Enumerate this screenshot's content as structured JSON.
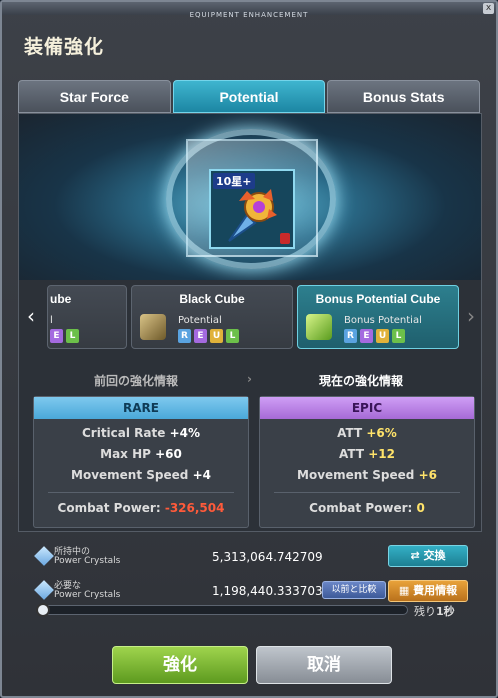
{
  "window": {
    "title": "EQUIPMENT ENHANCEMENT",
    "close_glyph": "x"
  },
  "heading": "装備強化",
  "tabs": [
    {
      "label": "Star Force",
      "active": false
    },
    {
      "label": "Potential",
      "active": true
    },
    {
      "label": "Bonus Stats",
      "active": false
    }
  ],
  "item": {
    "star_label": "10星+",
    "icon": "sword-item-icon"
  },
  "cubes": [
    {
      "name": "ube",
      "sub": "l",
      "grades": [
        "E",
        "L"
      ]
    },
    {
      "name": "Black Cube",
      "sub": "Potential",
      "grades": [
        "R",
        "E",
        "U",
        "L"
      ]
    },
    {
      "name": "Bonus Potential Cube",
      "sub": "Bonus Potential",
      "grades": [
        "R",
        "E",
        "U",
        "L"
      ]
    }
  ],
  "compare": {
    "prev_title": "前回の強化情報",
    "curr_title": "現在の強化情報",
    "prev": {
      "grade": "RARE",
      "stats": [
        {
          "label": "Critical Rate",
          "value": "+4%"
        },
        {
          "label": "Max HP",
          "value": "+60"
        },
        {
          "label": "Movement Speed",
          "value": "+4"
        }
      ],
      "combat_label": "Combat Power:",
      "combat_value": "-326,504"
    },
    "curr": {
      "grade": "EPIC",
      "stats": [
        {
          "label": "ATT",
          "value": "+6%"
        },
        {
          "label": "ATT",
          "value": "+12"
        },
        {
          "label": "Movement Speed",
          "value": "+6"
        }
      ],
      "combat_label": "Combat Power:",
      "combat_value": "0"
    }
  },
  "crystals": {
    "owned_label_jp": "所持中の",
    "owned_label_en": "Power Crystals",
    "owned_value": "5,313,064.742709",
    "exchange_label": "交換",
    "required_label_jp": "必要な",
    "required_label_en": "Power Crystals",
    "required_value": "1,198,440.333703",
    "compare_label": "以前と比較",
    "cost_info_label": "費用情報"
  },
  "timer": {
    "remaining_label": "残り",
    "remaining_value": "1秒",
    "progress": 0.0
  },
  "buttons": {
    "enhance": "強化",
    "cancel": "取消"
  }
}
